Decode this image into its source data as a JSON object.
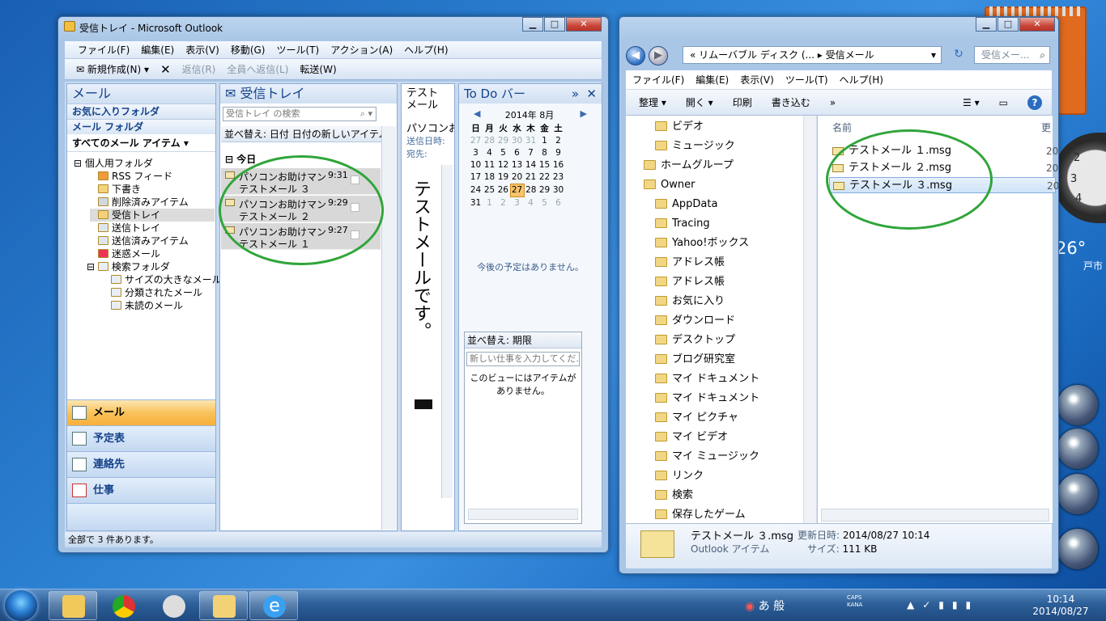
{
  "outlook": {
    "title": "受信トレイ - Microsoft Outlook",
    "menu": [
      "ファイル(F)",
      "編集(E)",
      "表示(V)",
      "移動(G)",
      "ツール(T)",
      "アクション(A)",
      "ヘルプ(H)"
    ],
    "toolbar": {
      "new": "新規作成(N)",
      "reply": "返信(R)",
      "reply_all": "全員へ返信(L)",
      "forward": "転送(W)"
    },
    "nav": {
      "header": "メール",
      "favorites": "お気に入りフォルダ",
      "mail_folders": "メール フォルダ",
      "all_items": "すべてのメール アイテム",
      "tree": [
        "個人用フォルダ",
        "RSS フィード",
        "下書き",
        "削除済みアイテム",
        "受信トレイ",
        "送信トレイ",
        "送信済みアイテム",
        "迷惑メール",
        "検索フォルダ",
        "サイズの大きなメール",
        "分類されたメール",
        "未読のメール"
      ],
      "buttons": [
        "メール",
        "予定表",
        "連絡先",
        "仕事"
      ]
    },
    "inbox": {
      "header": "受信トレイ",
      "search_placeholder": "受信トレイ の検索",
      "sort_label": "並べ替え: 日付",
      "sort_order": "日付の新しいアイテム",
      "group": "今日",
      "messages": [
        {
          "from": "パソコンお助けマン",
          "subject": "テストメール ３",
          "time": "9:31"
        },
        {
          "from": "パソコンお助けマン",
          "subject": "テストメール ２",
          "time": "9:29"
        },
        {
          "from": "パソコンお助けマン",
          "subject": "テストメール １",
          "time": "9:27"
        }
      ]
    },
    "reading": {
      "subject": "テストメール",
      "from": "パソコンお",
      "sent_label": "送信日時:",
      "to_label": "宛先:",
      "body": "テストメールです。"
    },
    "todo": {
      "header": "To Do バー",
      "month": "2014年 8月",
      "weekdays": [
        "日",
        "月",
        "火",
        "水",
        "木",
        "金",
        "土"
      ],
      "weeks": [
        [
          "27",
          "28",
          "29",
          "30",
          "31",
          "1",
          "2"
        ],
        [
          "3",
          "4",
          "5",
          "6",
          "7",
          "8",
          "9"
        ],
        [
          "10",
          "11",
          "12",
          "13",
          "14",
          "15",
          "16"
        ],
        [
          "17",
          "18",
          "19",
          "20",
          "21",
          "22",
          "23"
        ],
        [
          "24",
          "25",
          "26",
          "27",
          "28",
          "29",
          "30"
        ],
        [
          "31",
          "1",
          "2",
          "3",
          "4",
          "5",
          "6"
        ]
      ],
      "today": "27",
      "no_appointments": "今後の予定はありません。",
      "task_sort": "並べ替え: 期限",
      "task_placeholder": "新しい仕事を入力してくだ...",
      "no_items": "このビューにはアイテムがありません。"
    },
    "status": "全部で 3 件あります。"
  },
  "explorer": {
    "address": "« リムーバブル ディスク (... ▸ 受信メール",
    "search_placeholder": "受信メー...",
    "menu": [
      "ファイル(F)",
      "編集(E)",
      "表示(V)",
      "ツール(T)",
      "ヘルプ(H)"
    ],
    "commands": [
      "整理 ▾",
      "開く ▾",
      "印刷",
      "書き込む",
      "»"
    ],
    "tree": [
      "ビデオ",
      "ミュージック",
      "ホームグループ",
      "Owner",
      "AppData",
      "Tracing",
      "Yahoo!ボックス",
      "アドレス帳",
      "アドレス帳",
      "お気に入り",
      "ダウンロード",
      "デスクトップ",
      "ブログ研究室",
      "マイ ドキュメント",
      "マイ ドキュメント",
      "マイ ピクチャ",
      "マイ ビデオ",
      "マイ ミュージック",
      "リンク",
      "検索",
      "保存したゲーム"
    ],
    "column_name": "名前",
    "column_date": "更",
    "files": [
      "テストメール １.msg",
      "テストメール ２.msg",
      "テストメール ３.msg"
    ],
    "file_date_prefix": "20",
    "details": {
      "name": "テストメール ３.msg",
      "modified_label": "更新日時:",
      "modified": "2014/08/27 10:14",
      "type": "Outlook アイテム",
      "size_label": "サイズ:",
      "size": "111 KB"
    }
  },
  "desktop": {
    "weather_temp": "26°",
    "weather_city": "戸市"
  },
  "taskbar": {
    "ime": "あ 般",
    "caps": "CAPS",
    "kana": "KANA",
    "time": "10:14",
    "date": "2014/08/27"
  }
}
